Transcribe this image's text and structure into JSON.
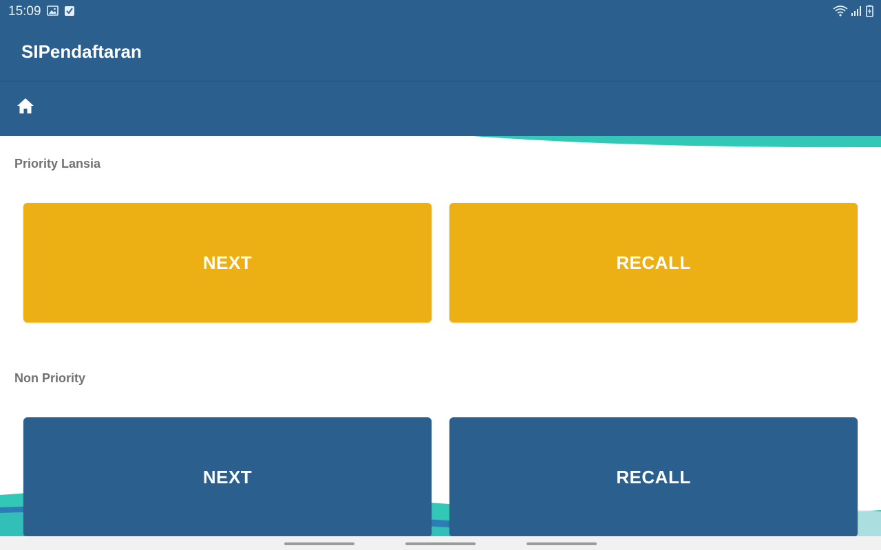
{
  "status_bar": {
    "time": "15:09",
    "left_icons": [
      "image-icon",
      "checkbox-icon"
    ],
    "right_icons": [
      "wifi-icon",
      "signal-icon",
      "battery-charging-icon"
    ]
  },
  "app_bar": {
    "title": "SIPendaftaran"
  },
  "toolbar": {
    "home_icon": "home-icon"
  },
  "sections": [
    {
      "label": "Priority Lansia",
      "next_label": "NEXT",
      "recall_label": "RECALL",
      "color": "#ECAF14"
    },
    {
      "label": "Non Priority",
      "next_label": "NEXT",
      "recall_label": "RECALL",
      "color": "#2A5F8E"
    }
  ],
  "colors": {
    "primary": "#2A5F8E",
    "accent_teal": "#33C7B8",
    "priority_yellow": "#ECAF14"
  }
}
